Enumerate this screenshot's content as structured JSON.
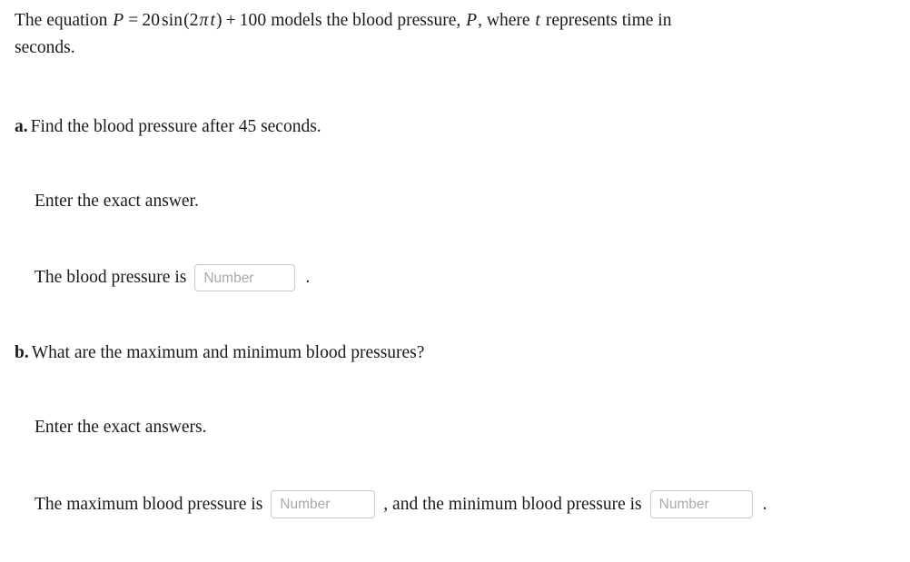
{
  "problem": {
    "intro_before_equation": "The equation",
    "equation": {
      "lhs": "P",
      "equals": "=",
      "amplitude": "20",
      "function": "sin",
      "open_paren": "(",
      "arg_coefficient": "2",
      "arg_pi": "π",
      "arg_variable": "t",
      "close_paren": ")",
      "plus": "+",
      "vertical_shift": "100",
      "plain_text": "P = 20 sin(2πt) + 100"
    },
    "intro_after_equation": "models the blood pressure,",
    "pressure_variable": "P",
    "intro_comma": ",",
    "intro_where": "where",
    "time_variable": "t",
    "intro_tail": "represents time in",
    "intro_lastline": "seconds."
  },
  "parts": {
    "a": {
      "label": "a.",
      "question": "Find the blood pressure after 45 seconds.",
      "instruction": "Enter the exact answer.",
      "answer_prefix": "The blood pressure is",
      "answer_suffix": ".",
      "input": {
        "name": "blood-pressure",
        "value": "",
        "placeholder": "Number"
      }
    },
    "b": {
      "label": "b.",
      "question": "What are the maximum and minimum blood pressures?",
      "instruction": "Enter the exact answers.",
      "answer_prefix": "The maximum blood pressure is",
      "answer_middle": ", and the minimum blood pressure is",
      "answer_suffix": ".",
      "input_max": {
        "name": "maximum-blood-pressure",
        "value": "",
        "placeholder": "Number"
      },
      "input_min": {
        "name": "minimum-blood-pressure",
        "value": "",
        "placeholder": "Number"
      }
    }
  },
  "colors": {
    "background": "#ffffff",
    "text": "#1a1a1a",
    "input_border": "#c9c9c9",
    "placeholder": "#a9a9a9"
  }
}
